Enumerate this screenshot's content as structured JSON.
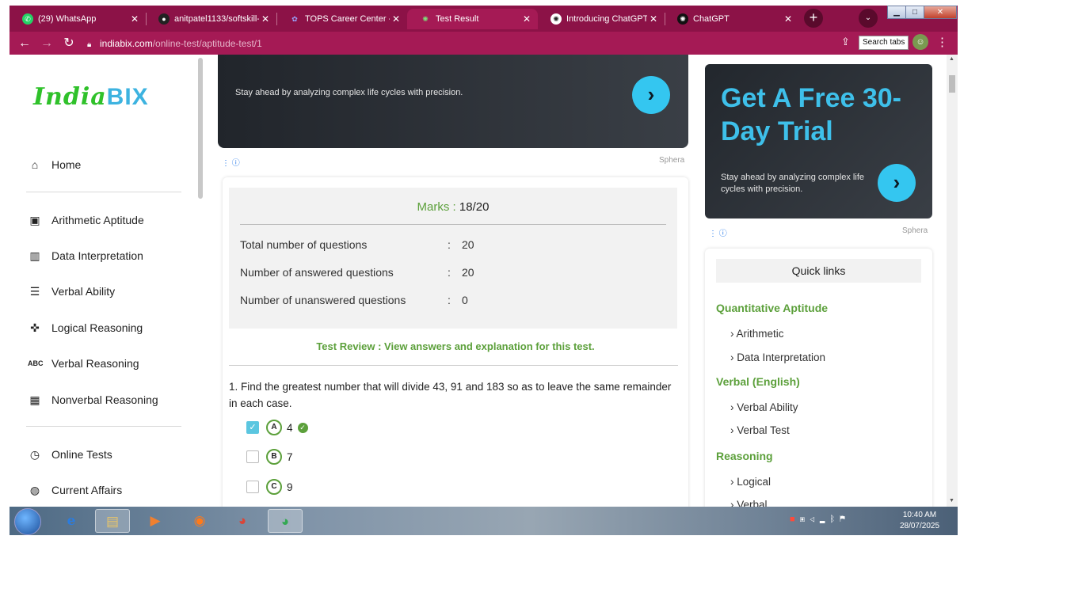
{
  "browser": {
    "tabs": [
      {
        "title": "(29) WhatsApp",
        "icon": "whatsapp-icon",
        "color": "#25d366"
      },
      {
        "title": "anitpatel1133/softskill-",
        "icon": "github-icon",
        "color": "#222222"
      },
      {
        "title": "TOPS Career Center - W",
        "icon": "tops-icon",
        "color": "#5b6bd6"
      },
      {
        "title": "Test Result",
        "icon": "indiabix-icon",
        "color": "#3db3e0",
        "active": true
      },
      {
        "title": "Introducing ChatGPT | C",
        "icon": "openai-icon",
        "color": "#ffffff"
      },
      {
        "title": "ChatGPT",
        "icon": "chatgpt-icon",
        "color": "#111111"
      }
    ],
    "new_tab": "+",
    "tab_search": "⌄",
    "url_host": "indiabix.com",
    "url_path": "/online-test/aptitude-test/1",
    "search_tabs": "Search tabs",
    "accent": "#8c1247"
  },
  "sidebar": {
    "logo_part1": "IndiaBIX",
    "home": "Home",
    "items": [
      {
        "label": "Arithmetic Aptitude",
        "icon": "calculator-icon"
      },
      {
        "label": "Data Interpretation",
        "icon": "bar-chart-icon"
      },
      {
        "label": "Verbal Ability",
        "icon": "document-check-icon"
      },
      {
        "label": "Logical Reasoning",
        "icon": "puzzle-icon"
      },
      {
        "label": "Verbal Reasoning",
        "icon": "abc-icon"
      },
      {
        "label": "Nonverbal Reasoning",
        "icon": "grid-icon"
      }
    ],
    "online_tests": "Online Tests",
    "current_affairs": "Current Affairs"
  },
  "ad_top": {
    "text": "Stay ahead by analyzing complex life cycles with precision.",
    "brand": "Sphera"
  },
  "result": {
    "marks_label": "Marks :",
    "marks_value": "18/20",
    "stats": [
      {
        "label": "Total number of questions",
        "sep": ":",
        "value": "20"
      },
      {
        "label": "Number of answered questions",
        "sep": ":",
        "value": "20"
      },
      {
        "label": "Number of unanswered questions",
        "sep": ":",
        "value": "0"
      }
    ],
    "review": "Test Review : View answers and explanation for this test.",
    "question_number": "1.",
    "question": "Find the greatest number that will divide 43, 91 and 183 so as to leave the same remainder in each case.",
    "options": [
      {
        "letter": "A",
        "text": "4",
        "checked": true,
        "correct": true
      },
      {
        "letter": "B",
        "text": "7",
        "checked": false,
        "correct": false
      },
      {
        "letter": "C",
        "text": "9",
        "checked": false,
        "correct": false
      }
    ]
  },
  "ad_right": {
    "headline": "Get A Free 30-Day Trial",
    "text": "Stay ahead by analyzing complex life cycles with precision.",
    "brand": "Sphera"
  },
  "quick_links": {
    "title": "Quick links",
    "sections": [
      {
        "title": "Quantitative Aptitude",
        "links": [
          "Arithmetic",
          "Data Interpretation"
        ]
      },
      {
        "title": "Verbal (English)",
        "links": [
          "Verbal Ability",
          "Verbal Test"
        ]
      },
      {
        "title": "Reasoning",
        "links": [
          "Logical",
          "Verbal"
        ]
      }
    ]
  },
  "taskbar": {
    "time": "10:40 AM",
    "date": "28/07/2025"
  }
}
